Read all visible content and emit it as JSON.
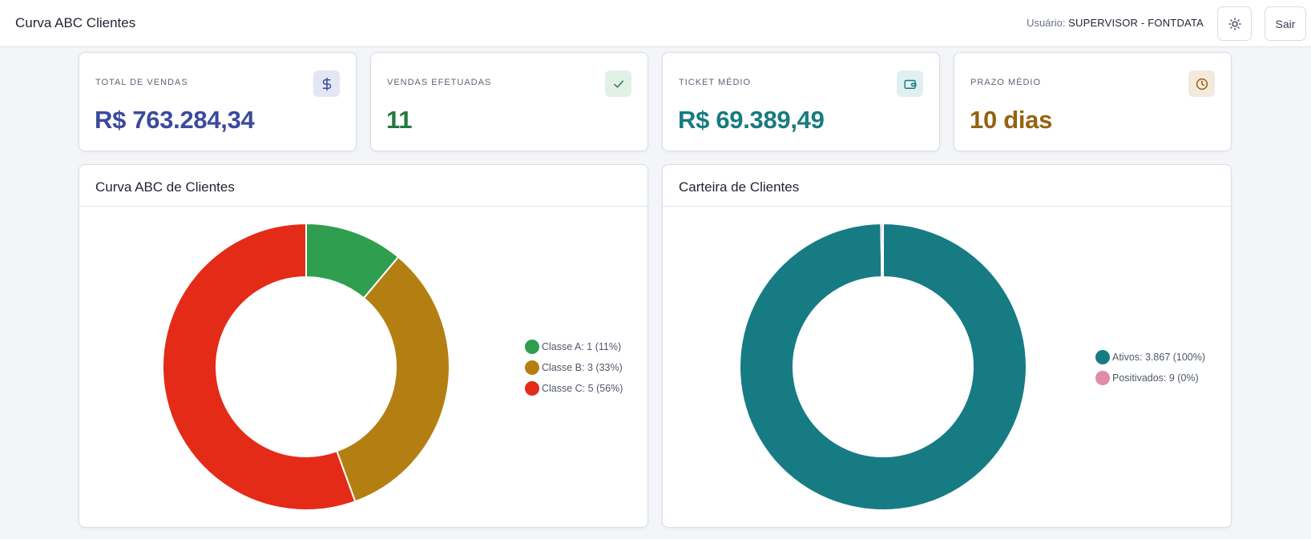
{
  "header": {
    "title": "Curva ABC Clientes",
    "user_prefix": "Usuário:",
    "user_name": "SUPERVISOR - FONTDATA",
    "theme_icon": "sun-icon",
    "logout_label": "Sair"
  },
  "kpis": [
    {
      "label": "TOTAL DE VENDAS",
      "value": "R$ 763.284,34",
      "color": "#3b4a9e",
      "icon": "dollar-icon",
      "icon_bg": "#e3e6f3"
    },
    {
      "label": "VENDAS EFETUADAS",
      "value": "11",
      "color": "#237a3f",
      "icon": "check-icon",
      "icon_bg": "#e2f1e6"
    },
    {
      "label": "TICKET MÉDIO",
      "value": "R$ 69.389,49",
      "color": "#177b80",
      "icon": "wallet-icon",
      "icon_bg": "#e0f0f1"
    },
    {
      "label": "PRAZO MÉDIO",
      "value": "10 dias",
      "color": "#946310",
      "icon": "clock-icon",
      "icon_bg": "#f3e9dc"
    }
  ],
  "charts": {
    "abc": {
      "title": "Curva ABC de Clientes",
      "legend": [
        "Classe A: 1 (11%)",
        "Classe B: 3 (33%)",
        "Classe C: 5 (56%)"
      ]
    },
    "carteira": {
      "title": "Carteira de Clientes",
      "legend": [
        "Ativos: 3.867 (100%)",
        "Positivados: 9 (0%)"
      ]
    }
  },
  "chart_data": [
    {
      "type": "pie",
      "title": "Curva ABC de Clientes",
      "series": [
        {
          "name": "Classe A",
          "value": 1,
          "percent": 11,
          "color": "#2f9e4e"
        },
        {
          "name": "Classe B",
          "value": 3,
          "percent": 33,
          "color": "#b47f12"
        },
        {
          "name": "Classe C",
          "value": 5,
          "percent": 56,
          "color": "#e32b18"
        }
      ]
    },
    {
      "type": "pie",
      "title": "Carteira de Clientes",
      "series": [
        {
          "name": "Ativos",
          "value": 3867,
          "percent": 100,
          "color": "#177b84"
        },
        {
          "name": "Positivados",
          "value": 9,
          "percent": 0,
          "color": "#e08ba8"
        }
      ]
    }
  ]
}
